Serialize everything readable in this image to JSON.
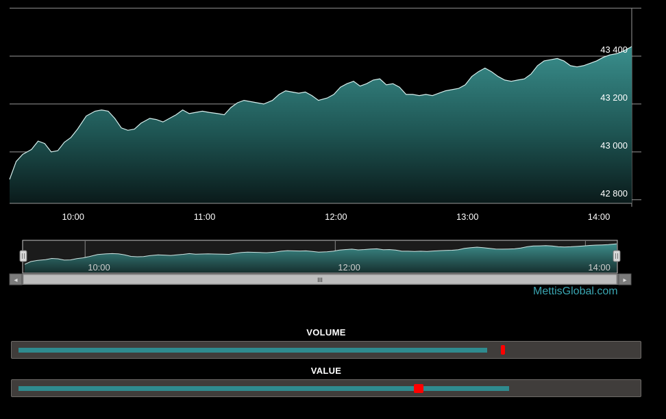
{
  "chart_data": {
    "type": "area",
    "title": "",
    "xlabel": "",
    "ylabel": "",
    "x_ticks": [
      "10:00",
      "11:00",
      "12:00",
      "13:00",
      "14:00"
    ],
    "y_ticks": [
      42800,
      43000,
      43200,
      43400
    ],
    "y_tick_labels": [
      "42 800",
      "43 000",
      "43 200",
      "43 400"
    ],
    "xlim": [
      "09:31",
      "14:15"
    ],
    "ylim": [
      42785,
      43600
    ],
    "grid": true,
    "series": [
      {
        "values": [
          [
            "09:31",
            42885
          ],
          [
            "09:34",
            42960
          ],
          [
            "09:37",
            42990
          ],
          [
            "09:41",
            43010
          ],
          [
            "09:44",
            43045
          ],
          [
            "09:47",
            43035
          ],
          [
            "09:50",
            43000
          ],
          [
            "09:53",
            43005
          ],
          [
            "09:56",
            43040
          ],
          [
            "09:59",
            43060
          ],
          [
            "10:02",
            43095
          ],
          [
            "10:06",
            43150
          ],
          [
            "10:10",
            43170
          ],
          [
            "10:13",
            43175
          ],
          [
            "10:16",
            43170
          ],
          [
            "10:19",
            43140
          ],
          [
            "10:22",
            43100
          ],
          [
            "10:25",
            43090
          ],
          [
            "10:28",
            43095
          ],
          [
            "10:31",
            43120
          ],
          [
            "10:35",
            43140
          ],
          [
            "10:38",
            43135
          ],
          [
            "10:41",
            43125
          ],
          [
            "10:44",
            43140
          ],
          [
            "10:47",
            43155
          ],
          [
            "10:50",
            43175
          ],
          [
            "10:53",
            43160
          ],
          [
            "10:56",
            43165
          ],
          [
            "10:59",
            43170
          ],
          [
            "11:02",
            43165
          ],
          [
            "11:06",
            43160
          ],
          [
            "11:09",
            43155
          ],
          [
            "11:12",
            43185
          ],
          [
            "11:15",
            43205
          ],
          [
            "11:18",
            43215
          ],
          [
            "11:21",
            43210
          ],
          [
            "11:24",
            43205
          ],
          [
            "11:27",
            43200
          ],
          [
            "11:31",
            43215
          ],
          [
            "11:34",
            43240
          ],
          [
            "11:37",
            43255
          ],
          [
            "11:40",
            43250
          ],
          [
            "11:43",
            43245
          ],
          [
            "11:46",
            43250
          ],
          [
            "11:49",
            43235
          ],
          [
            "11:52",
            43215
          ],
          [
            "11:56",
            43225
          ],
          [
            "11:59",
            43240
          ],
          [
            "12:02",
            43270
          ],
          [
            "12:05",
            43285
          ],
          [
            "12:08",
            43295
          ],
          [
            "12:11",
            43275
          ],
          [
            "12:14",
            43285
          ],
          [
            "12:17",
            43300
          ],
          [
            "12:20",
            43305
          ],
          [
            "12:23",
            43280
          ],
          [
            "12:26",
            43285
          ],
          [
            "12:29",
            43270
          ],
          [
            "12:32",
            43240
          ],
          [
            "12:35",
            43240
          ],
          [
            "12:38",
            43235
          ],
          [
            "12:41",
            43240
          ],
          [
            "12:44",
            43235
          ],
          [
            "12:47",
            43245
          ],
          [
            "12:50",
            43255
          ],
          [
            "12:53",
            43260
          ],
          [
            "12:56",
            43265
          ],
          [
            "12:59",
            43280
          ],
          [
            "13:02",
            43315
          ],
          [
            "13:05",
            43335
          ],
          [
            "13:08",
            43350
          ],
          [
            "13:11",
            43335
          ],
          [
            "13:14",
            43315
          ],
          [
            "13:17",
            43300
          ],
          [
            "13:20",
            43295
          ],
          [
            "13:23",
            43300
          ],
          [
            "13:26",
            43305
          ],
          [
            "13:29",
            43325
          ],
          [
            "13:32",
            43360
          ],
          [
            "13:35",
            43380
          ],
          [
            "13:38",
            43385
          ],
          [
            "13:41",
            43390
          ],
          [
            "13:44",
            43380
          ],
          [
            "13:47",
            43360
          ],
          [
            "13:50",
            43355
          ],
          [
            "13:53",
            43360
          ],
          [
            "13:56",
            43370
          ],
          [
            "13:59",
            43380
          ],
          [
            "14:02",
            43395
          ],
          [
            "14:05",
            43405
          ],
          [
            "14:08",
            43410
          ],
          [
            "14:11",
            43420
          ],
          [
            "14:15",
            43440
          ]
        ]
      }
    ]
  },
  "navigator": {
    "x_ticks": [
      "10:00",
      "12:00",
      "14:00"
    ],
    "scrollbar_grip": "III",
    "left_arrow": "◂",
    "right_arrow": "▸"
  },
  "brand": "MettisGlobal.com",
  "meters": {
    "volume": {
      "title": "VOLUME",
      "fill": 0.762,
      "marker": 0.787
    },
    "value": {
      "title": "VALUE",
      "fill": 0.797,
      "marker": 0.65
    }
  },
  "colors": {
    "background": "#000000",
    "area_fill_top": "#3a8f8d",
    "area_fill_bottom": "#0a1a1a",
    "line": "#d7f0ee",
    "grid": "#9a9a9a",
    "meter_bar": "#2f8b8f",
    "meter_marker": "#ff0000"
  }
}
